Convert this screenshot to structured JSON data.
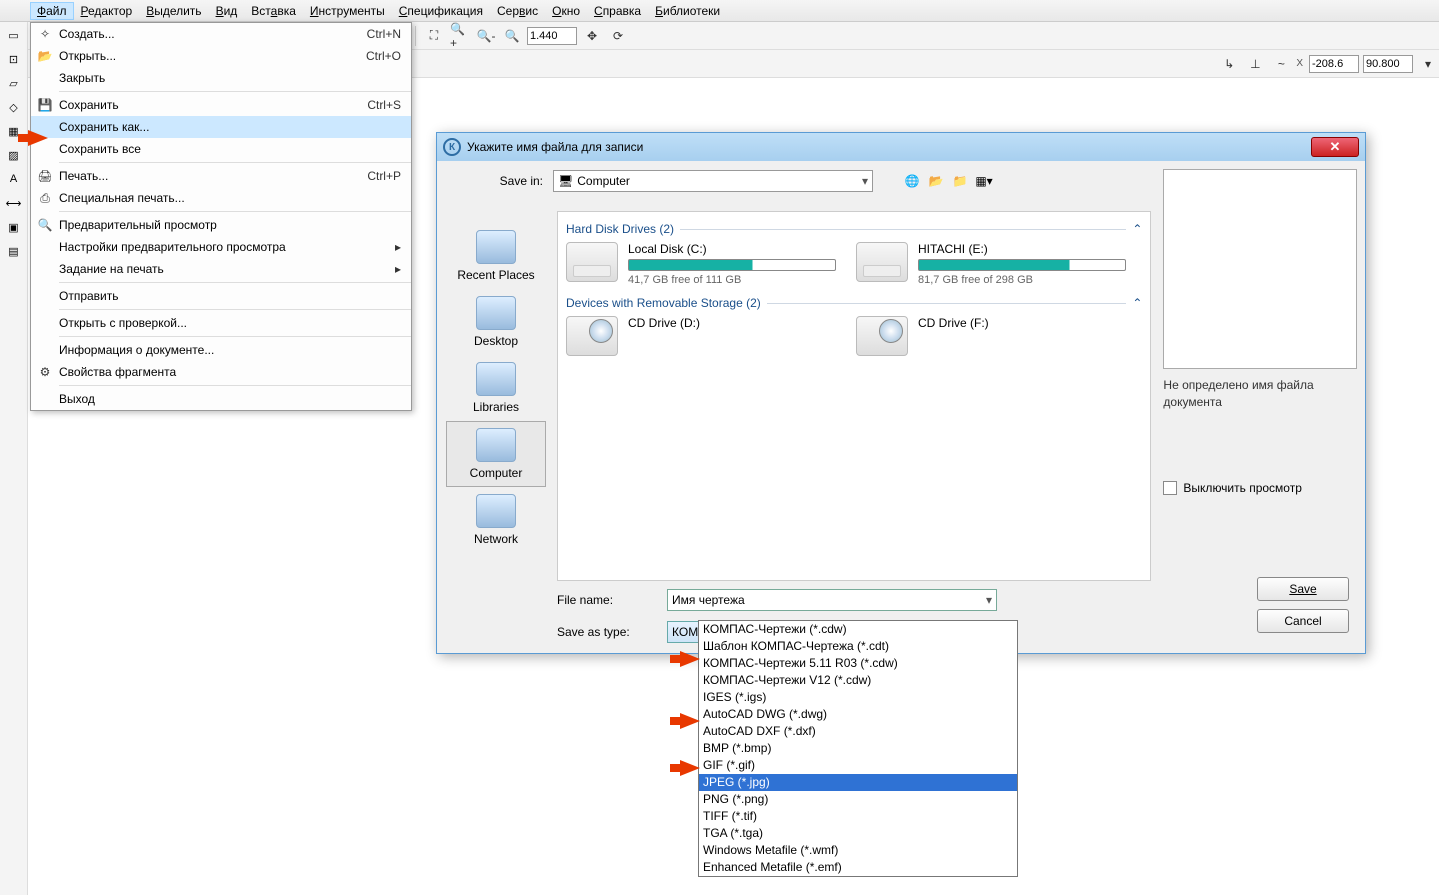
{
  "menubar": [
    "Файл",
    "Редактор",
    "Выделить",
    "Вид",
    "Вставка",
    "Инструменты",
    "Спецификация",
    "Сервис",
    "Окно",
    "Справка",
    "Библиотеки"
  ],
  "menubar_underline_idx": [
    0,
    0,
    0,
    0,
    3,
    0,
    0,
    3,
    0,
    0,
    0
  ],
  "toolbar2": {
    "zoom": "1.440",
    "coord_x": "-208.6",
    "coord_y": "90.800"
  },
  "file_menu": [
    {
      "icon": "✧",
      "label": "Создать...",
      "shortcut": "Ctrl+N"
    },
    {
      "icon": "📂",
      "label": "Открыть...",
      "shortcut": "Ctrl+O"
    },
    {
      "icon": "",
      "label": "Закрыть",
      "shortcut": ""
    },
    {
      "sep": true
    },
    {
      "icon": "💾",
      "label": "Сохранить",
      "shortcut": "Ctrl+S"
    },
    {
      "icon": "",
      "label": "Сохранить как...",
      "shortcut": "",
      "hl": true
    },
    {
      "icon": "",
      "label": "Сохранить все",
      "shortcut": ""
    },
    {
      "sep": true
    },
    {
      "icon": "🖨",
      "label": "Печать...",
      "shortcut": "Ctrl+P"
    },
    {
      "icon": "⎙",
      "label": "Специальная печать...",
      "shortcut": ""
    },
    {
      "sep": true
    },
    {
      "icon": "🔍",
      "label": "Предварительный просмотр",
      "shortcut": ""
    },
    {
      "icon": "",
      "label": "Настройки предварительного просмотра",
      "shortcut": "",
      "arrow": true
    },
    {
      "icon": "",
      "label": "Задание на печать",
      "shortcut": "",
      "arrow": true
    },
    {
      "sep": true
    },
    {
      "icon": "",
      "label": "Отправить",
      "shortcut": ""
    },
    {
      "sep": true
    },
    {
      "icon": "",
      "label": "Открыть с проверкой...",
      "shortcut": ""
    },
    {
      "sep": true
    },
    {
      "icon": "",
      "label": "Информация о документе...",
      "shortcut": ""
    },
    {
      "icon": "⚙",
      "label": "Свойства фрагмента",
      "shortcut": ""
    },
    {
      "sep": true
    },
    {
      "icon": "",
      "label": "Выход",
      "shortcut": ""
    }
  ],
  "dialog": {
    "title": "Укажите имя файла для записи",
    "save_in_label": "Save in:",
    "save_in_value": "Computer",
    "places": [
      "Recent Places",
      "Desktop",
      "Libraries",
      "Computer",
      "Network"
    ],
    "places_selected": 3,
    "section1": "Hard Disk Drives (2)",
    "section2": "Devices with Removable Storage (2)",
    "drives": [
      {
        "name": "Local Disk (C:)",
        "free": "41,7 GB free of 111 GB"
      },
      {
        "name": "HITACHI (E:)",
        "free": "81,7 GB free of 298 GB"
      }
    ],
    "cddrives": [
      {
        "name": "CD Drive (D:)"
      },
      {
        "name": "CD Drive (F:)"
      }
    ],
    "filename_label": "File name:",
    "filename_value": "Имя чертежа",
    "saveastype_label": "Save as type:",
    "saveastype_value": "КОМПАС-Чертежи (*.cdw)",
    "preview_text": "Не определено имя файла документа",
    "checkbox_label": "Выключить просмотр",
    "save_btn": "Save",
    "cancel_btn": "Cancel"
  },
  "formats": [
    "КОМПАС-Чертежи (*.cdw)",
    "Шаблон КОМПАС-Чертежа (*.cdt)",
    "КОМПАС-Чертежи 5.11 R03 (*.cdw)",
    "КОМПАС-Чертежи V12 (*.cdw)",
    "IGES (*.igs)",
    "AutoCAD DWG (*.dwg)",
    "AutoCAD DXF (*.dxf)",
    "BMP (*.bmp)",
    "GIF (*.gif)",
    "JPEG (*.jpg)",
    "PNG (*.png)",
    "TIFF (*.tif)",
    "TGA (*.tga)",
    "Windows Metafile (*.wmf)",
    "Enhanced Metafile (*.emf)"
  ],
  "format_selected_idx": 9,
  "arrow_format_idx": [
    2,
    6,
    9
  ]
}
